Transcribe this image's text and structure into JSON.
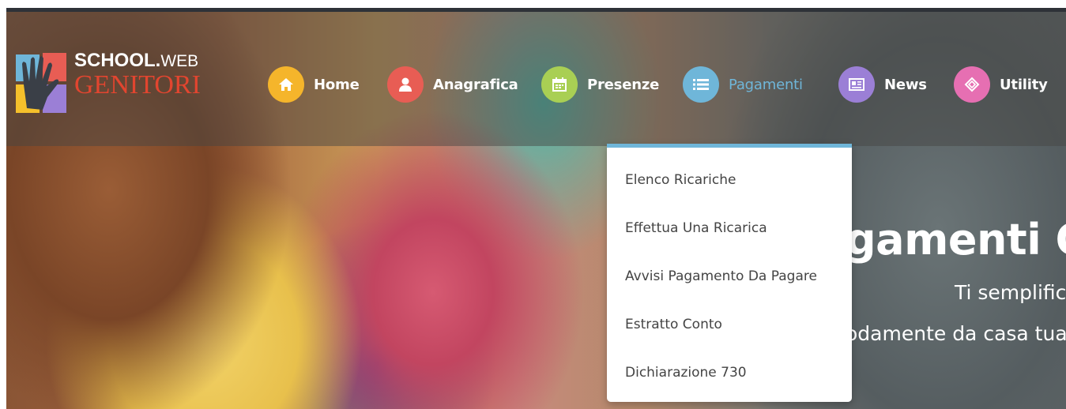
{
  "logo": {
    "school": "SCHOOL.",
    "web": "WEB",
    "genitori": "GENITORI"
  },
  "nav": [
    {
      "label": "Home",
      "icon": "home-icon",
      "color": "#f5b52b"
    },
    {
      "label": "Anagrafica",
      "icon": "user-icon",
      "color": "#e85d54"
    },
    {
      "label": "Presenze",
      "icon": "calendar-icon",
      "color": "#a9cf54"
    },
    {
      "label": "Pagamenti",
      "icon": "list-icon",
      "color": "#6fb6d9",
      "active": true
    },
    {
      "label": "News",
      "icon": "newspaper-icon",
      "color": "#9b7fd6"
    },
    {
      "label": "Utility",
      "icon": "utility-icon",
      "color": "#e66fb2"
    }
  ],
  "dropdown": {
    "items": [
      "Elenco Ricariche",
      "Effettua Una Ricarica",
      "Avvisi Pagamento Da Pagare",
      "Estratto Conto",
      "Dichiarazione 730"
    ]
  },
  "hero": {
    "title": "gamenti On",
    "line1": "Ti semplific",
    "line2": "odamente da casa tua"
  }
}
